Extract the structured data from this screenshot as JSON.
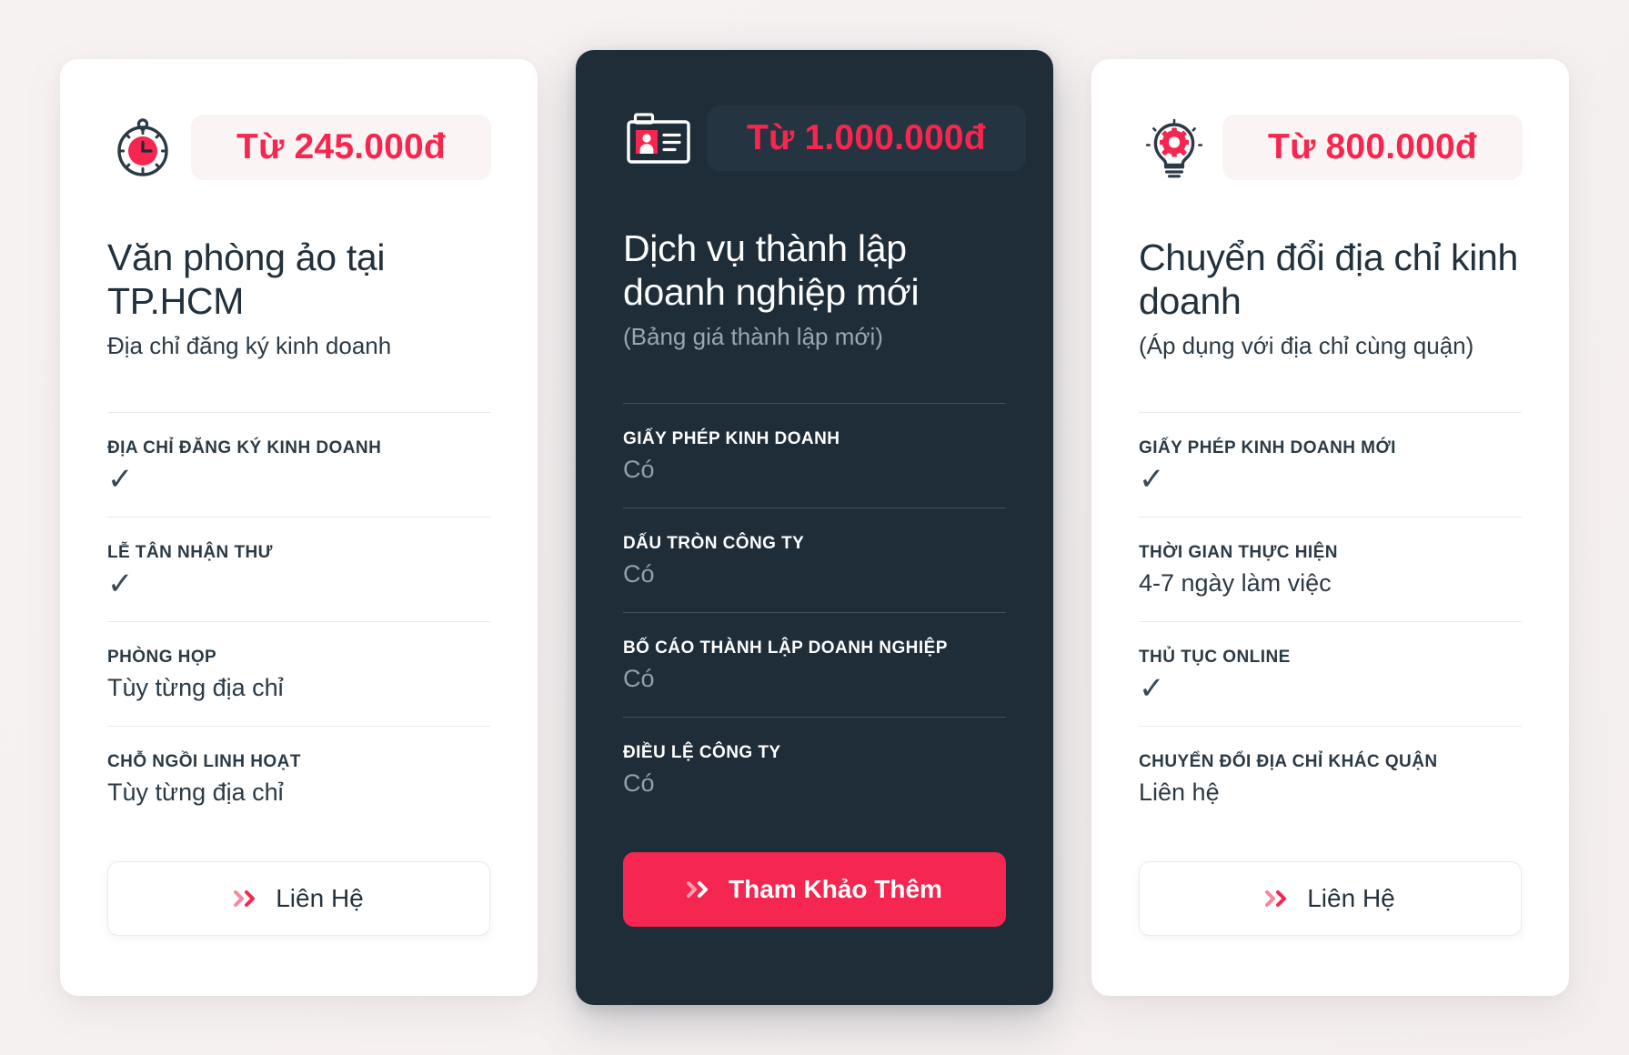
{
  "theme": {
    "accent": "#f5264f",
    "dark_card_bg": "#1e2d38",
    "page_bg": "#f6f1f1",
    "text_dark": "#2b3a45",
    "muted_on_dark": "#93a0ab"
  },
  "cards": [
    {
      "icon": "stopwatch-icon",
      "price": "Từ 245.000đ",
      "title": "Văn phòng ảo tại TP.HCM",
      "subtitle": "Địa chỉ đăng ký kinh doanh",
      "features": [
        {
          "label": "ĐỊA CHỈ ĐĂNG KÝ KINH DOANH",
          "value": "✓",
          "is_check": true
        },
        {
          "label": "LỄ TÂN NHẬN THƯ",
          "value": "✓",
          "is_check": true
        },
        {
          "label": "PHÒNG HỌP",
          "value": "Tùy từng địa chỉ",
          "is_check": false
        },
        {
          "label": "CHỖ NGỒI LINH HOẠT",
          "value": "Tùy từng địa chỉ",
          "is_check": false
        }
      ],
      "cta_label": "Liên Hệ",
      "featured": false
    },
    {
      "icon": "id-card-icon",
      "price": "Từ 1.000.000đ",
      "title": "Dịch vụ thành lập doanh nghiệp mới",
      "subtitle": "(Bảng giá thành lập mới)",
      "features": [
        {
          "label": "GIẤY PHÉP KINH DOANH",
          "value": "Có",
          "is_check": false
        },
        {
          "label": "DẤU TRÒN CÔNG TY",
          "value": "Có",
          "is_check": false
        },
        {
          "label": "BỐ CÁO THÀNH LẬP DOANH NGHIỆP",
          "value": "Có",
          "is_check": false
        },
        {
          "label": "ĐIỀU LỆ CÔNG TY",
          "value": "Có",
          "is_check": false
        }
      ],
      "cta_label": "Tham Khảo Thêm",
      "featured": true
    },
    {
      "icon": "lightbulb-gear-icon",
      "price": "Từ 800.000đ",
      "title": "Chuyển đổi địa chỉ kinh doanh",
      "subtitle": "(Áp dụng với địa chỉ cùng quận)",
      "features": [
        {
          "label": "GIẤY PHÉP KINH DOANH MỚI",
          "value": "✓",
          "is_check": true
        },
        {
          "label": "THỜI GIAN THỰC HIỆN",
          "value": "4-7 ngày làm việc",
          "is_check": false
        },
        {
          "label": "THỦ TỤC ONLINE",
          "value": "✓",
          "is_check": true
        },
        {
          "label": "CHUYỂN ĐỔI ĐỊA CHỈ KHÁC QUẬN",
          "value": "Liên hệ",
          "is_check": false
        }
      ],
      "cta_label": "Liên Hệ",
      "featured": false
    }
  ]
}
